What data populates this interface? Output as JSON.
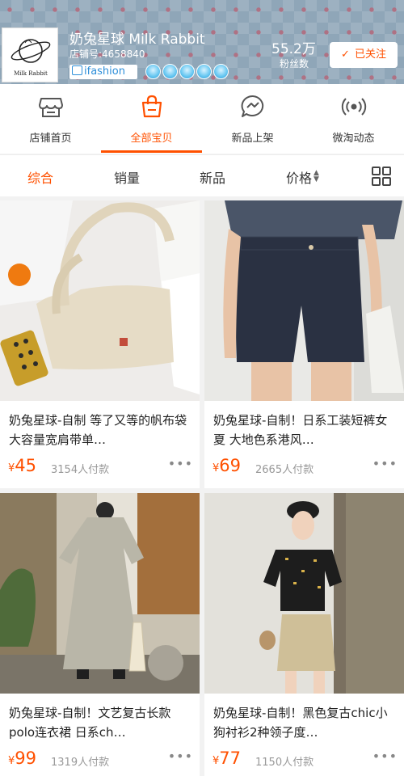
{
  "shop": {
    "name": "奶兔星球 Milk Rabbit",
    "shop_id": "店铺号:4658840",
    "logo_text": "Milk Rabbit",
    "badge": "ifashion",
    "fans_count": "55.2万",
    "fans_label": "粉丝数",
    "follow_label": "已关注"
  },
  "tabs": [
    {
      "label": "店铺首页",
      "icon": "store-icon"
    },
    {
      "label": "全部宝贝",
      "icon": "shopping-bag-icon",
      "active": true
    },
    {
      "label": "新品上架",
      "icon": "new-arrival-icon"
    },
    {
      "label": "微淘动态",
      "icon": "feed-icon"
    }
  ],
  "sort": {
    "comprehensive": "综合",
    "sales": "销量",
    "new": "新品",
    "price": "价格"
  },
  "currency": "¥",
  "products": [
    {
      "title": "奶兔星球-自制 等了又等的帆布袋 大容量宽肩带单…",
      "price": "45",
      "sold": "3154人付款",
      "more": "•••"
    },
    {
      "title": "奶兔星球-自制！日系工装短裤女夏 大地色系港风…",
      "price": "69",
      "sold": "2665人付款",
      "more": "•••"
    },
    {
      "title": "奶兔星球-自制！文艺复古长款polo连衣裙 日系ch…",
      "price": "99",
      "sold": "1319人付款",
      "more": "•••"
    },
    {
      "title": "奶兔星球-自制！黑色复古chic小狗衬衫2种领子度…",
      "price": "77",
      "sold": "1150人付款",
      "more": "•••"
    }
  ],
  "colors": {
    "accent": "#ff5000",
    "header_bg": "#8fa6b8",
    "badge_blue": "#2e8fd9"
  }
}
